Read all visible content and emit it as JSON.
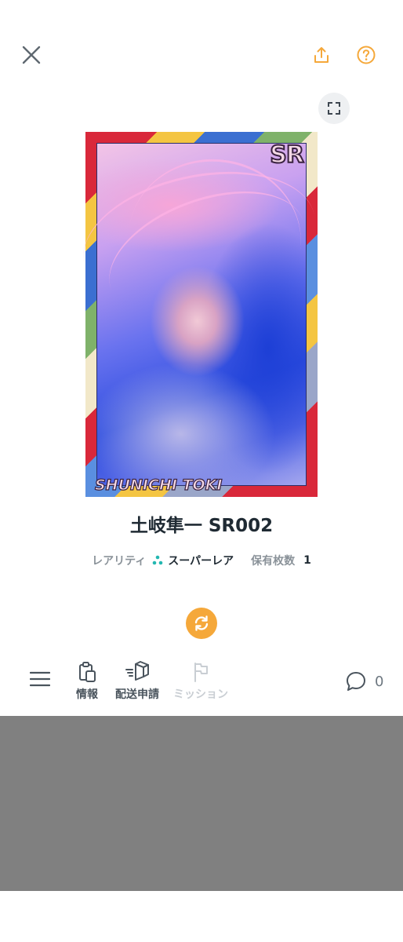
{
  "header": {
    "close_icon": "close-icon",
    "share_icon": "share-icon",
    "help_icon": "help-circle-icon",
    "expand_icon": "expand-icon",
    "accent_color": "#f5a83a"
  },
  "card": {
    "rank_mark": "SR",
    "name_art": "SHUNICHI TOKI"
  },
  "title": "土岐隼一 SR002",
  "meta": {
    "rarity_label": "レアリティ",
    "rarity_value": "スーパーレア",
    "owned_label": "保有枚数",
    "owned_value": "1"
  },
  "toolbar": {
    "info_label": "情報",
    "shipping_label": "配送申請",
    "mission_label": "ミッション",
    "comment_count": "0"
  }
}
